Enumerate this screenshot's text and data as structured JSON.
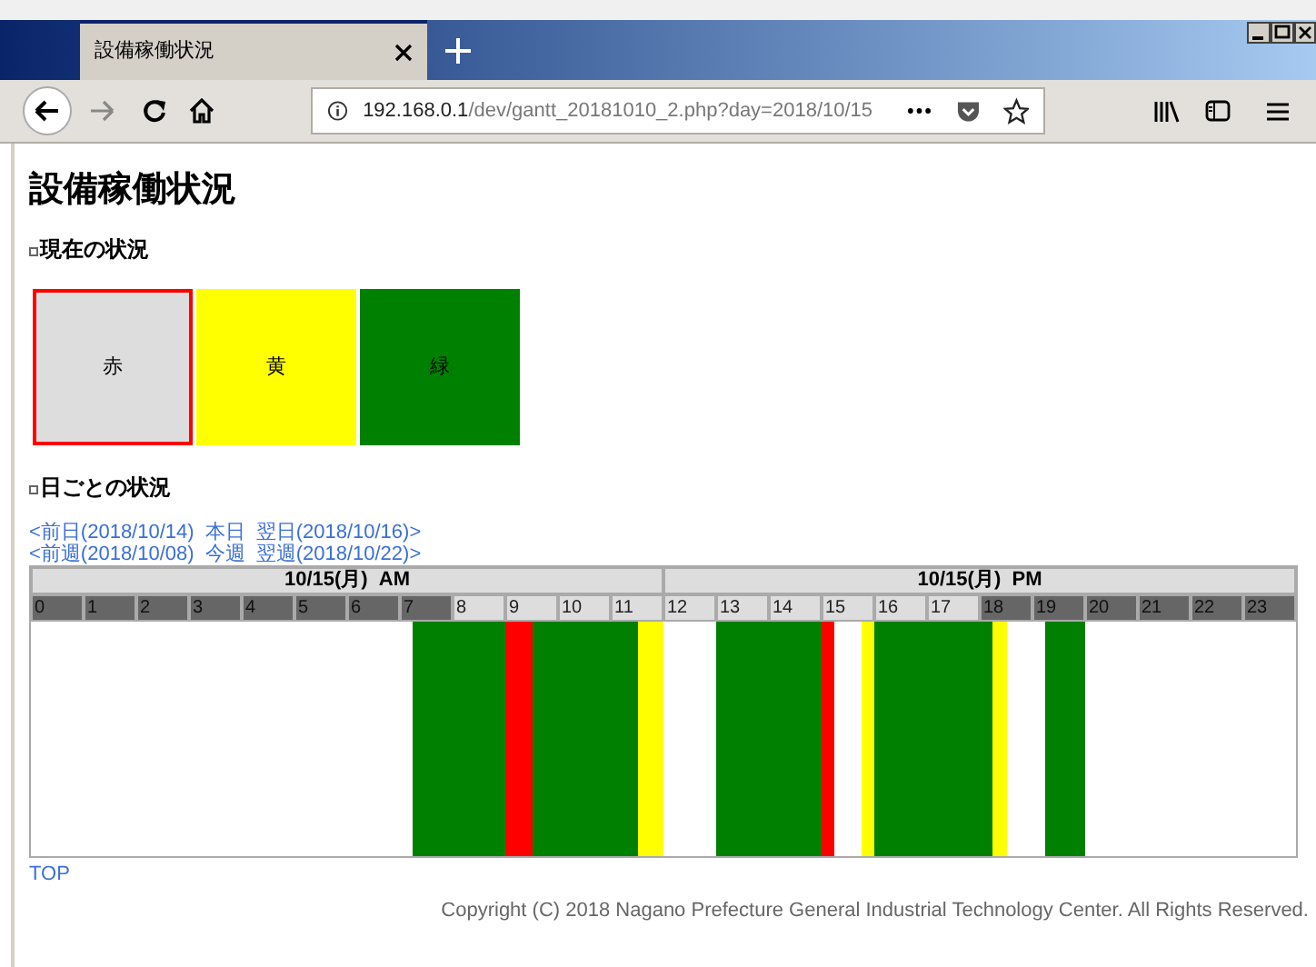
{
  "browser": {
    "tab_title": "設備稼働状況",
    "url_host": "192.168.0.1",
    "url_path": "/dev/gantt_20181010_2.php?day=2018/10/15"
  },
  "page": {
    "title": "設備稼働状況",
    "current": {
      "heading": "現在の状況",
      "lamps": [
        {
          "label": "赤",
          "color": "#ff0000",
          "lit": false
        },
        {
          "label": "黄",
          "color": "#ffff00",
          "lit": true
        },
        {
          "label": "緑",
          "color": "#008000",
          "lit": true
        }
      ]
    },
    "daily": {
      "heading": "日ごとの状況",
      "day_links": [
        "<前日(2018/10/14)",
        "本日",
        "翌日(2018/10/16)>"
      ],
      "week_links": [
        "<前週(2018/10/08)",
        "今週",
        "翌週(2018/10/22)>"
      ],
      "gantt": {
        "halves": [
          "10/15(月)  AM",
          "10/15(月)  PM"
        ],
        "hours": [
          {
            "label": "0",
            "shaded": true,
            "quarters": [
              {
                "kind": "idle"
              },
              {
                "kind": "idle"
              },
              {
                "kind": "idle"
              },
              {
                "kind": "idle"
              }
            ]
          },
          {
            "label": "1",
            "shaded": true,
            "quarters": [
              {
                "kind": "idle"
              },
              {
                "kind": "idle"
              },
              {
                "kind": "idle"
              },
              {
                "kind": "idle"
              }
            ]
          },
          {
            "label": "2",
            "shaded": true,
            "quarters": [
              {
                "kind": "idle"
              },
              {
                "kind": "idle"
              },
              {
                "kind": "idle"
              },
              {
                "kind": "idle"
              }
            ]
          },
          {
            "label": "3",
            "shaded": true,
            "quarters": [
              {
                "kind": "idle"
              },
              {
                "kind": "idle"
              },
              {
                "kind": "idle"
              },
              {
                "kind": "idle"
              }
            ]
          },
          {
            "label": "4",
            "shaded": true,
            "quarters": [
              {
                "kind": "idle"
              },
              {
                "kind": "idle"
              },
              {
                "kind": "idle"
              },
              {
                "kind": "idle"
              }
            ]
          },
          {
            "label": "5",
            "shaded": true,
            "quarters": [
              {
                "kind": "idle"
              },
              {
                "kind": "idle"
              },
              {
                "kind": "idle"
              },
              {
                "kind": "idle"
              }
            ]
          },
          {
            "label": "6",
            "shaded": true,
            "quarters": [
              {
                "kind": "idle"
              },
              {
                "kind": "idle"
              },
              {
                "kind": "idle"
              },
              {
                "kind": "idle"
              }
            ]
          },
          {
            "label": "7",
            "shaded": true,
            "quarters": [
              {
                "kind": "idle"
              },
              {
                "kind": "status",
                "color": "#008000"
              },
              {
                "kind": "status",
                "color": "#008000"
              },
              {
                "kind": "status",
                "color": "#008000"
              }
            ]
          },
          {
            "label": "8",
            "shaded": false,
            "quarters": [
              {
                "kind": "status",
                "color": "#008000"
              },
              {
                "kind": "status",
                "color": "#008000"
              },
              {
                "kind": "status",
                "color": "#008000"
              },
              {
                "kind": "status",
                "color": "#008000"
              }
            ]
          },
          {
            "label": "9",
            "shaded": false,
            "quarters": [
              {
                "kind": "status",
                "color": "#ff0000"
              },
              {
                "kind": "status",
                "color": "#ff0000"
              },
              {
                "kind": "status",
                "color": "#008000"
              },
              {
                "kind": "status",
                "color": "#008000"
              }
            ]
          },
          {
            "label": "10",
            "shaded": false,
            "quarters": [
              {
                "kind": "status",
                "color": "#008000"
              },
              {
                "kind": "status",
                "color": "#008000"
              },
              {
                "kind": "status",
                "color": "#008000"
              },
              {
                "kind": "status",
                "color": "#008000"
              }
            ]
          },
          {
            "label": "11",
            "shaded": false,
            "quarters": [
              {
                "kind": "status",
                "color": "#008000"
              },
              {
                "kind": "status",
                "color": "#008000"
              },
              {
                "kind": "status",
                "color": "#ffff00"
              },
              {
                "kind": "status",
                "color": "#ffff00"
              }
            ]
          },
          {
            "label": "12",
            "shaded": false,
            "quarters": [
              {
                "kind": "idle"
              },
              {
                "kind": "idle"
              },
              {
                "kind": "idle"
              },
              {
                "kind": "idle"
              }
            ]
          },
          {
            "label": "13",
            "shaded": false,
            "quarters": [
              {
                "kind": "status",
                "color": "#008000"
              },
              {
                "kind": "status",
                "color": "#008000"
              },
              {
                "kind": "status",
                "color": "#008000"
              },
              {
                "kind": "status",
                "color": "#008000"
              }
            ]
          },
          {
            "label": "14",
            "shaded": false,
            "quarters": [
              {
                "kind": "status",
                "color": "#008000"
              },
              {
                "kind": "status",
                "color": "#008000"
              },
              {
                "kind": "status",
                "color": "#008000"
              },
              {
                "kind": "status",
                "color": "#008000"
              }
            ]
          },
          {
            "label": "15",
            "shaded": false,
            "quarters": [
              {
                "kind": "status",
                "color": "#ff0000"
              },
              {
                "kind": "idle"
              },
              {
                "kind": "idle"
              },
              {
                "kind": "status",
                "color": "#ffff00"
              }
            ]
          },
          {
            "label": "16",
            "shaded": false,
            "quarters": [
              {
                "kind": "status",
                "color": "#008000"
              },
              {
                "kind": "status",
                "color": "#008000"
              },
              {
                "kind": "status",
                "color": "#008000"
              },
              {
                "kind": "status",
                "color": "#008000"
              }
            ]
          },
          {
            "label": "17",
            "shaded": false,
            "quarters": [
              {
                "kind": "status",
                "color": "#008000"
              },
              {
                "kind": "status",
                "color": "#008000"
              },
              {
                "kind": "status",
                "color": "#008000"
              },
              {
                "kind": "status",
                "color": "#008000"
              }
            ]
          },
          {
            "label": "18",
            "shaded": true,
            "quarters": [
              {
                "kind": "status",
                "color": "#008000"
              },
              {
                "kind": "status",
                "color": "#ffff00"
              },
              {
                "kind": "idle"
              },
              {
                "kind": "idle"
              }
            ]
          },
          {
            "label": "19",
            "shaded": true,
            "quarters": [
              {
                "kind": "idle"
              },
              {
                "kind": "status",
                "color": "#008000"
              },
              {
                "kind": "status",
                "color": "#008000"
              },
              {
                "kind": "status",
                "color": "#008000"
              }
            ]
          },
          {
            "label": "20",
            "shaded": true,
            "quarters": [
              {
                "kind": "idle"
              },
              {
                "kind": "idle"
              },
              {
                "kind": "idle"
              },
              {
                "kind": "idle"
              }
            ]
          },
          {
            "label": "21",
            "shaded": true,
            "quarters": [
              {
                "kind": "idle"
              },
              {
                "kind": "idle"
              },
              {
                "kind": "idle"
              },
              {
                "kind": "idle"
              }
            ]
          },
          {
            "label": "22",
            "shaded": true,
            "quarters": [
              {
                "kind": "idle"
              },
              {
                "kind": "idle"
              },
              {
                "kind": "idle"
              },
              {
                "kind": "idle"
              }
            ]
          },
          {
            "label": "23",
            "shaded": true,
            "quarters": [
              {
                "kind": "idle"
              },
              {
                "kind": "idle"
              },
              {
                "kind": "idle"
              },
              {
                "kind": "idle"
              }
            ]
          }
        ]
      }
    },
    "top_link": "TOP",
    "copyright": "Copyright (C) 2018 Nagano Prefecture General Industrial Technology Center. All Rights Reserved."
  }
}
